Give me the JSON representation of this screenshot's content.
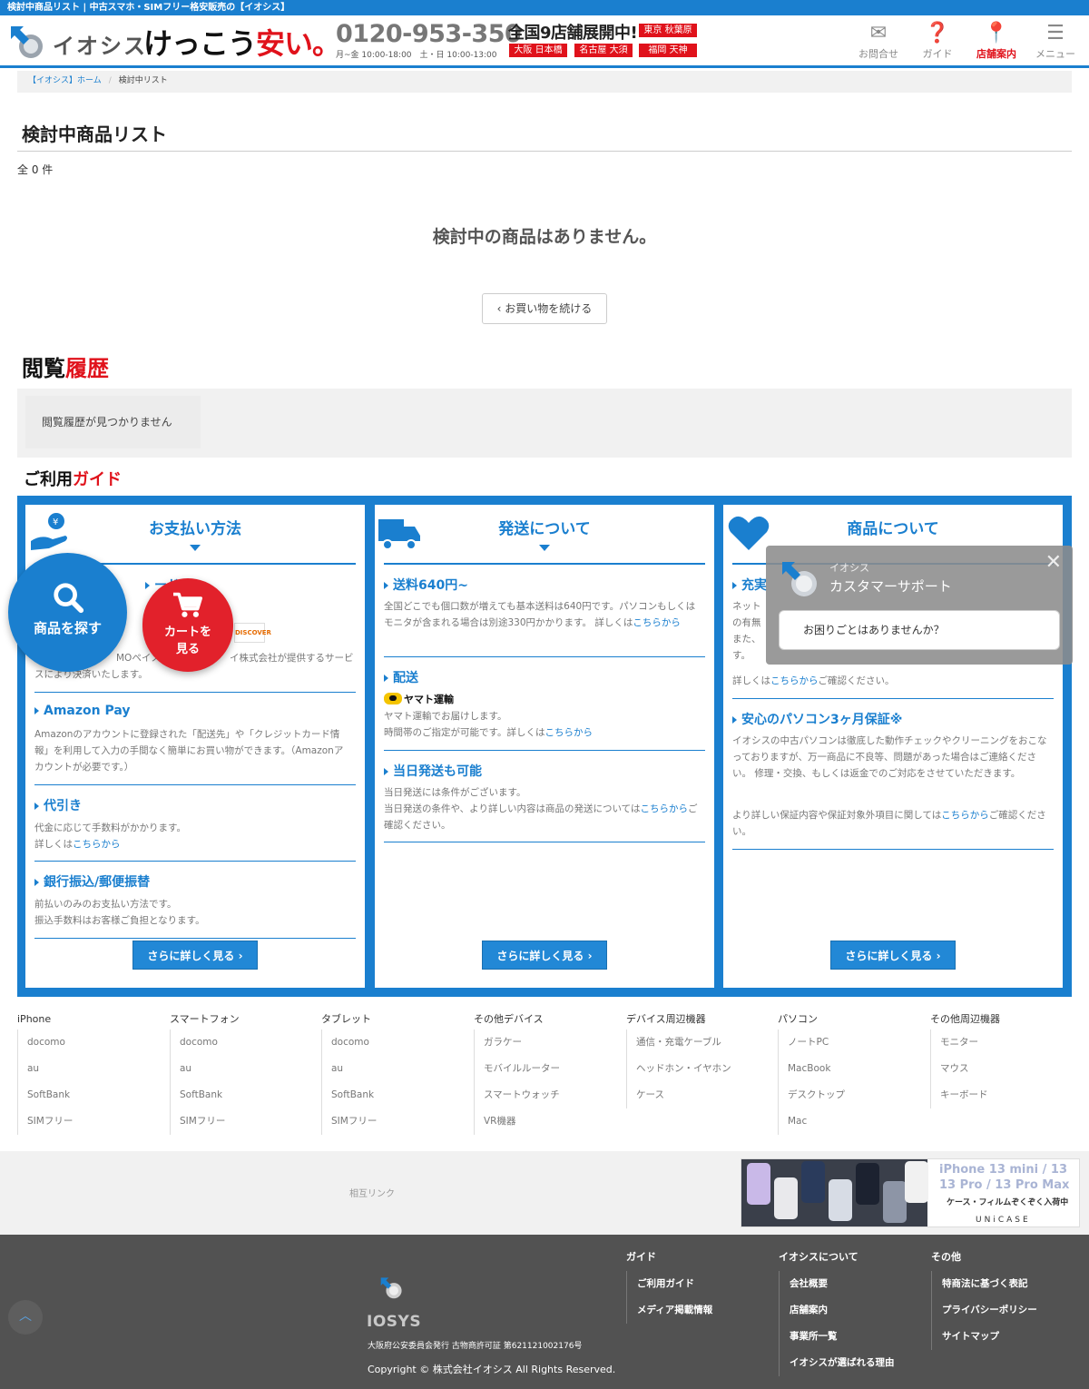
{
  "topbar": {
    "text": "検討中商品リスト | 中古スマホ・SIMフリー格安販売の【イオシス】"
  },
  "header": {
    "logo_text": "イオシス",
    "slogan_a": "けっこう",
    "slogan_b": "安い",
    "slogan_c": "。",
    "tel": "0120-953-350",
    "hours": "月~金 10:00-18:00　土・日 10:00-13:00",
    "stores_title": "全国9店舗展開中!",
    "stores": [
      "東京 秋葉原",
      "大阪 日本橋",
      "名古屋 大須",
      "福岡 天神"
    ],
    "nav": [
      {
        "label": "お問合せ",
        "icon": "mail-icon"
      },
      {
        "label": "ガイド",
        "icon": "question-icon"
      },
      {
        "label": "店舗案内",
        "icon": "map-pin-icon"
      },
      {
        "label": "メニュー",
        "icon": "menu-icon"
      }
    ]
  },
  "breadcrumb": {
    "home": "【イオシス】ホーム",
    "current": "検討中リスト"
  },
  "main": {
    "title": "検討中商品リスト",
    "count": "全 0 件",
    "empty": "検討中の商品はありません。",
    "continue": "お買い物を続ける"
  },
  "history": {
    "title_a": "閲覧",
    "title_b": "履歴",
    "empty": "閲覧履歴が見つかりません"
  },
  "guide": {
    "title_a": "ご利用",
    "title_b": "ガイド",
    "more": "さらに詳しく見る",
    "link": "こちらから",
    "payment": {
      "head": "お支払い方法",
      "card_head_tail": "ード",
      "card_text_a": "MOペイメン",
      "card_text_b": "イ株式会社が提供するサービ",
      "card_text_c": "スにより決済いたします。",
      "amazon_head": "Amazon Pay",
      "amazon_text": "Amazonのアカウントに登録された「配送先」や「クレジットカード情報」を利用して入力の手間なく簡単にお買い物ができます。（Amazonアカウントが必要です。）",
      "cod_head": "代引き",
      "cod_text1": "代金に応じて手数料がかかります。",
      "cod_text2": "詳しくは",
      "bank_head": "銀行振込/郵便振替",
      "bank_text1": "前払いのみのお支払い方法です。",
      "bank_text2": "振込手数料はお客様ご負担となります。"
    },
    "shipping": {
      "head": "発送について",
      "fee_head": "送料640円~",
      "fee_text": "全国どこでも個口数が増えても基本送料は640円です。パソコンもしくはモニタが含まれる場合は別途330円かかります。 詳しくは",
      "delivery_head": "配送",
      "yamato": "ヤマト運輸",
      "delivery_text1": "ヤマト運輸でお届けします。",
      "delivery_text2": "時間帯のご指定が可能です。詳しくは",
      "sameday_head": "当日発送も可能",
      "sameday_text1": "当日発送には条件がございます。",
      "sameday_text2": "当日発送の条件や、より詳しい内容は商品の発送については",
      "sameday_link": "こちらから",
      "sameday_tail": "ご確認ください。"
    },
    "product": {
      "head": "商品について",
      "a_head": "充実",
      "a_text1": "ネット",
      "a_text2": "の有無",
      "a_text3": "また、",
      "a_text4": "す。",
      "a_more_a": "詳しくは",
      "a_more_b": "ご確認ください。",
      "pc_head": "安心のパソコン3ヶ月保証※",
      "pc_text": "イオシスの中古パソコンは徹底した動作チェックやクリーニングをおこなっておりますが、万一商品に不良等、問題があった場合はご連絡ください。 修理・交換、もしくは返金でのご対応をさせていただきます。",
      "pc_more_a": "より詳しい保証内容や保証対象外項目に関しては",
      "pc_more_b": "ご確認ください。"
    }
  },
  "categories": [
    {
      "head": "iPhone",
      "items": [
        "docomo",
        "au",
        "SoftBank",
        "SIMフリー"
      ]
    },
    {
      "head": "スマートフォン",
      "items": [
        "docomo",
        "au",
        "SoftBank",
        "SIMフリー"
      ]
    },
    {
      "head": "タブレット",
      "items": [
        "docomo",
        "au",
        "SoftBank",
        "SIMフリー"
      ]
    },
    {
      "head": "その他デバイス",
      "items": [
        "ガラケー",
        "モバイルルーター",
        "スマートウォッチ",
        "VR機器"
      ]
    },
    {
      "head": "デバイス周辺機器",
      "items": [
        "通信・充電ケーブル",
        "ヘッドホン・イヤホン",
        "ケース"
      ]
    },
    {
      "head": "パソコン",
      "items": [
        "ノートPC",
        "MacBook",
        "デスクトップ",
        "Mac"
      ]
    },
    {
      "head": "その他周辺機器",
      "items": [
        "モニター",
        "マウス",
        "キーボード"
      ]
    }
  ],
  "mutual": {
    "label": "相互リンク"
  },
  "banner": {
    "line1": "iPhone 13 mini / 13",
    "line2": "13 Pro / 13 Pro Max",
    "line3": "ケース・フィルムぞくぞく入荷中",
    "brand": "UNiCASE"
  },
  "footer": {
    "logo": "IOSYS",
    "permit": "大阪府公安委員会発行 古物商許可証 第621121002176号",
    "copyright": "Copyright © 株式会社イオシス All Rights Reserved.",
    "cols": [
      {
        "head": "ガイド",
        "items": [
          "ご利用ガイド",
          "メディア掲載情報"
        ]
      },
      {
        "head": "イオシスについて",
        "items": [
          "会社概要",
          "店舗案内",
          "事業所一覧",
          "イオシスが選ばれる理由"
        ]
      },
      {
        "head": "その他",
        "items": [
          "特商法に基づく表記",
          "プライバシーポリシー",
          "サイトマップ"
        ]
      }
    ]
  },
  "fab": {
    "search": "商品を探す",
    "cart_a": "カートを",
    "cart_b": "見る"
  },
  "chat": {
    "sub": "イオシス",
    "title": "カスタマーサポート",
    "message": "お困りごとはありませんか？"
  },
  "colors": {
    "brand_blue": "#1a7fcf",
    "accent_red": "#e0121b"
  }
}
